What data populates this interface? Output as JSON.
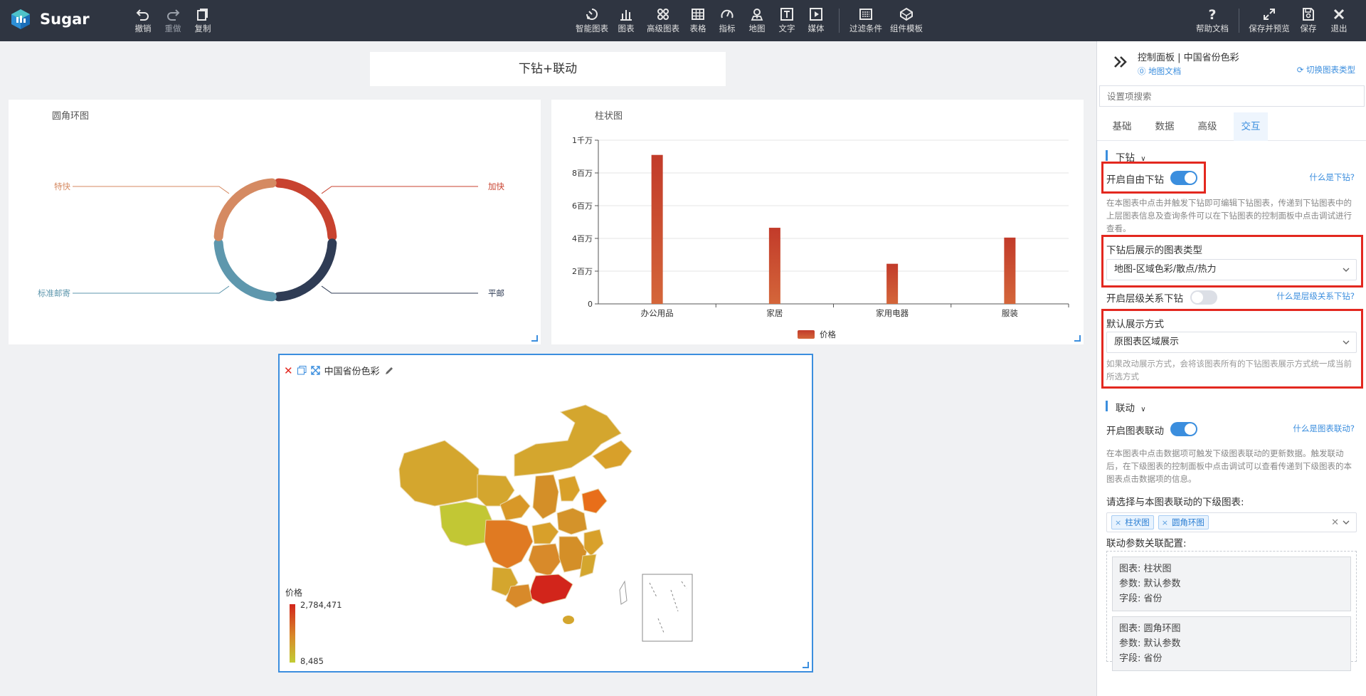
{
  "app": {
    "name": "Sugar"
  },
  "toolbar": {
    "left": [
      {
        "label": "撤销",
        "icon": "undo-icon"
      },
      {
        "label": "重做",
        "icon": "redo-icon"
      },
      {
        "label": "复制",
        "icon": "copy-icon"
      }
    ],
    "center": [
      {
        "label": "智能图表",
        "icon": "smart-chart-icon"
      },
      {
        "label": "图表",
        "icon": "chart-icon"
      },
      {
        "label": "高级图表",
        "icon": "advanced-chart-icon"
      },
      {
        "label": "表格",
        "icon": "table-icon"
      },
      {
        "label": "指标",
        "icon": "gauge-icon"
      },
      {
        "label": "地图",
        "icon": "map-pin-icon"
      },
      {
        "label": "文字",
        "icon": "text-icon"
      },
      {
        "label": "媒体",
        "icon": "media-icon"
      },
      {
        "label": "过滤条件",
        "icon": "filter-icon"
      },
      {
        "label": "组件模板",
        "icon": "template-icon"
      }
    ],
    "right": [
      {
        "label": "帮助文档",
        "icon": "help-icon"
      },
      {
        "label": "保存并预览",
        "icon": "expand-icon"
      },
      {
        "label": "保存",
        "icon": "save-icon"
      },
      {
        "label": "退出",
        "icon": "close-icon"
      }
    ]
  },
  "canvas": {
    "page_title": "下钻+联动",
    "donut_title": "圆角环图",
    "bar_title": "柱状图",
    "map_title": "中国省份色彩"
  },
  "chart_data": [
    {
      "type": "pie",
      "title": "圆角环图",
      "categories": [
        "加快",
        "平邮",
        "标准邮寄",
        "特快"
      ],
      "values": [
        25,
        25,
        25,
        25
      ],
      "colors": [
        "#c8422f",
        "#2f3c55",
        "#5e97ad",
        "#d58a62"
      ]
    },
    {
      "type": "bar",
      "title": "柱状图",
      "categories": [
        "办公用品",
        "家居",
        "家用电器",
        "服装"
      ],
      "series": [
        {
          "name": "价格",
          "values": [
            9100000,
            4650000,
            2450000,
            4050000
          ]
        }
      ],
      "ylim": [
        0,
        10000000
      ],
      "yticks": [
        "0",
        "2百万",
        "4百万",
        "6百万",
        "8百万",
        "1千万"
      ],
      "legend": "bottom-center",
      "grid": true,
      "color_top": "#c23b2a",
      "color_bottom": "#d4663a"
    },
    {
      "type": "heatmap",
      "title": "中国省份色彩",
      "legend_label": "价格",
      "max": "2,784,471",
      "min": "8,485",
      "color_high": "#d2251b",
      "color_low": "#c2cc34"
    }
  ],
  "panel": {
    "title": "控制面板 | 中国省份色彩",
    "doc_link": "地图文档",
    "switch_type": "切换图表类型",
    "search_placeholder": "设置项搜索",
    "tabs": [
      "基础",
      "数据",
      "高级",
      "交互"
    ],
    "active_tab": "交互",
    "drill": {
      "section": "下钻",
      "free_drill_label": "开启自由下钻",
      "free_drill_on": true,
      "what_is": "什么是下钻?",
      "desc": "在本图表中点击并触发下钻即可编辑下钻图表，传递到下钻图表中的上层图表信息及查询条件可以在下钻图表的控制面板中点击调试进行查看。",
      "type_label": "下钻后展示的图表类型",
      "type_value": "地图-区域色彩/散点/热力",
      "hier_label": "开启层级关系下钻",
      "hier_on": false,
      "hier_what": "什么是层级关系下钻?",
      "display_label": "默认展示方式",
      "display_value": "原图表区域展示",
      "display_desc": "如果改动展示方式，会将该图表所有的下钻图表展示方式统一成当前所选方式"
    },
    "link": {
      "section": "联动",
      "enable_label": "开启图表联动",
      "enable_on": true,
      "what_is": "什么是图表联动?",
      "desc": "在本图表中点击数据项可触发下级图表联动的更新数据。触发联动后，在下级图表的控制面板中点击调试可以查看传递到下级图表的本图表点击数据项的信息。",
      "select_label": "请选择与本图表联动的下级图表:",
      "tags": [
        "柱状图",
        "圆角环图"
      ],
      "params_label": "联动参数关联配置:",
      "params": [
        {
          "chart": "图表:  柱状图",
          "param": "参数:  默认参数",
          "field": "字段:  省份"
        },
        {
          "chart": "图表:  圆角环图",
          "param": "参数:  默认参数",
          "field": "字段:  省份"
        }
      ]
    }
  }
}
